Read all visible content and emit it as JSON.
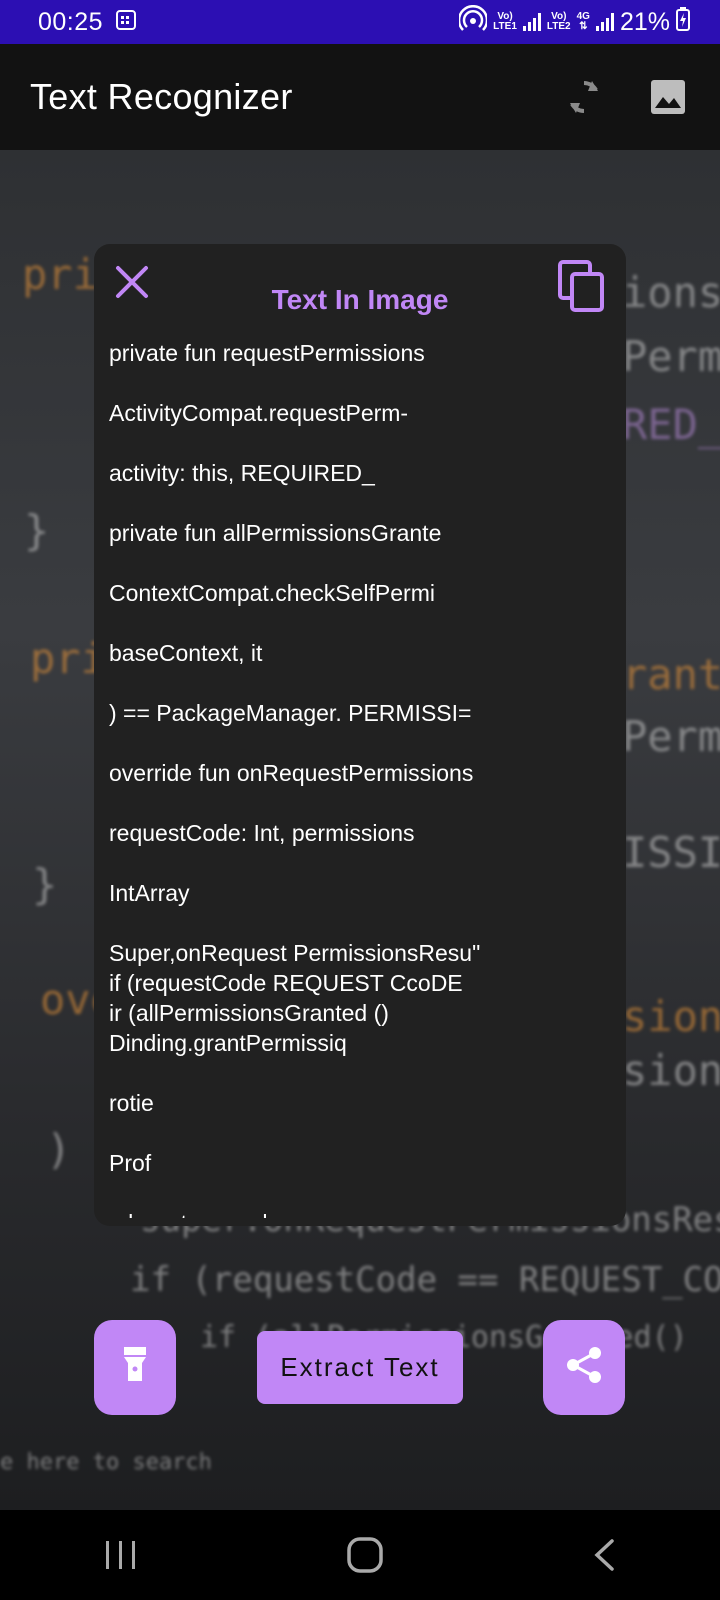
{
  "status_bar": {
    "time": "00:25",
    "net1_top": "Vo)",
    "net1_bottom": "LTE1",
    "net2_top": "Vo)",
    "net2_bottom": "LTE2",
    "net2_gen": "4G",
    "battery": "21%"
  },
  "app_bar": {
    "title": "Text Recognizer",
    "refresh_icon": "refresh-icon",
    "gallery_icon": "image-icon"
  },
  "preview": {
    "fragments": [
      "pri",
      "ions",
      "Perm",
      "RED_P",
      "}",
      "pri",
      "rante",
      "Permi",
      "ISSI",
      "}",
      "ove",
      "sions",
      "sions.",
      ")",
      "super.onRequestPermissionsResu",
      "if (requestCode == REQUEST_CODE",
      "if (allPermissionsGranted()",
      "e here to search"
    ]
  },
  "modal": {
    "title": "Text In Image",
    "close_icon": "close-icon",
    "copy_icon": "copy-icon",
    "lines": [
      "private fun requestPermissions",
      "ActivityCompat.requestPerm-",
      "activity: this, REQUIRED_",
      "private fun allPermissionsGrante",
      "ContextCompat.checkSelfPermi",
      "baseContext, it",
      ") == PackageManager. PERMISSI=",
      "override fun onRequestPermissions",
      "requestCode: Int, permissions",
      "IntArray",
      "Super,onRequest PermissionsResu\"",
      "if (requestCode REQUEST CcoDE",
      "ir (allPermissionsGranted ()",
      "Dinding.grantPermissiq",
      "rotie",
      "Prof",
      "e here to search"
    ]
  },
  "controls": {
    "flashlight_icon": "flashlight-icon",
    "extract_label": "Extract Text",
    "share_icon": "share-icon"
  },
  "nav_bar": {
    "recents_icon": "recents-icon",
    "home_icon": "home-icon",
    "back_icon": "back-icon"
  },
  "colors": {
    "accent": "#c187f6",
    "status_bar": "#2c0fb3",
    "app_bar": "#121212",
    "modal_bg": "#212121"
  }
}
